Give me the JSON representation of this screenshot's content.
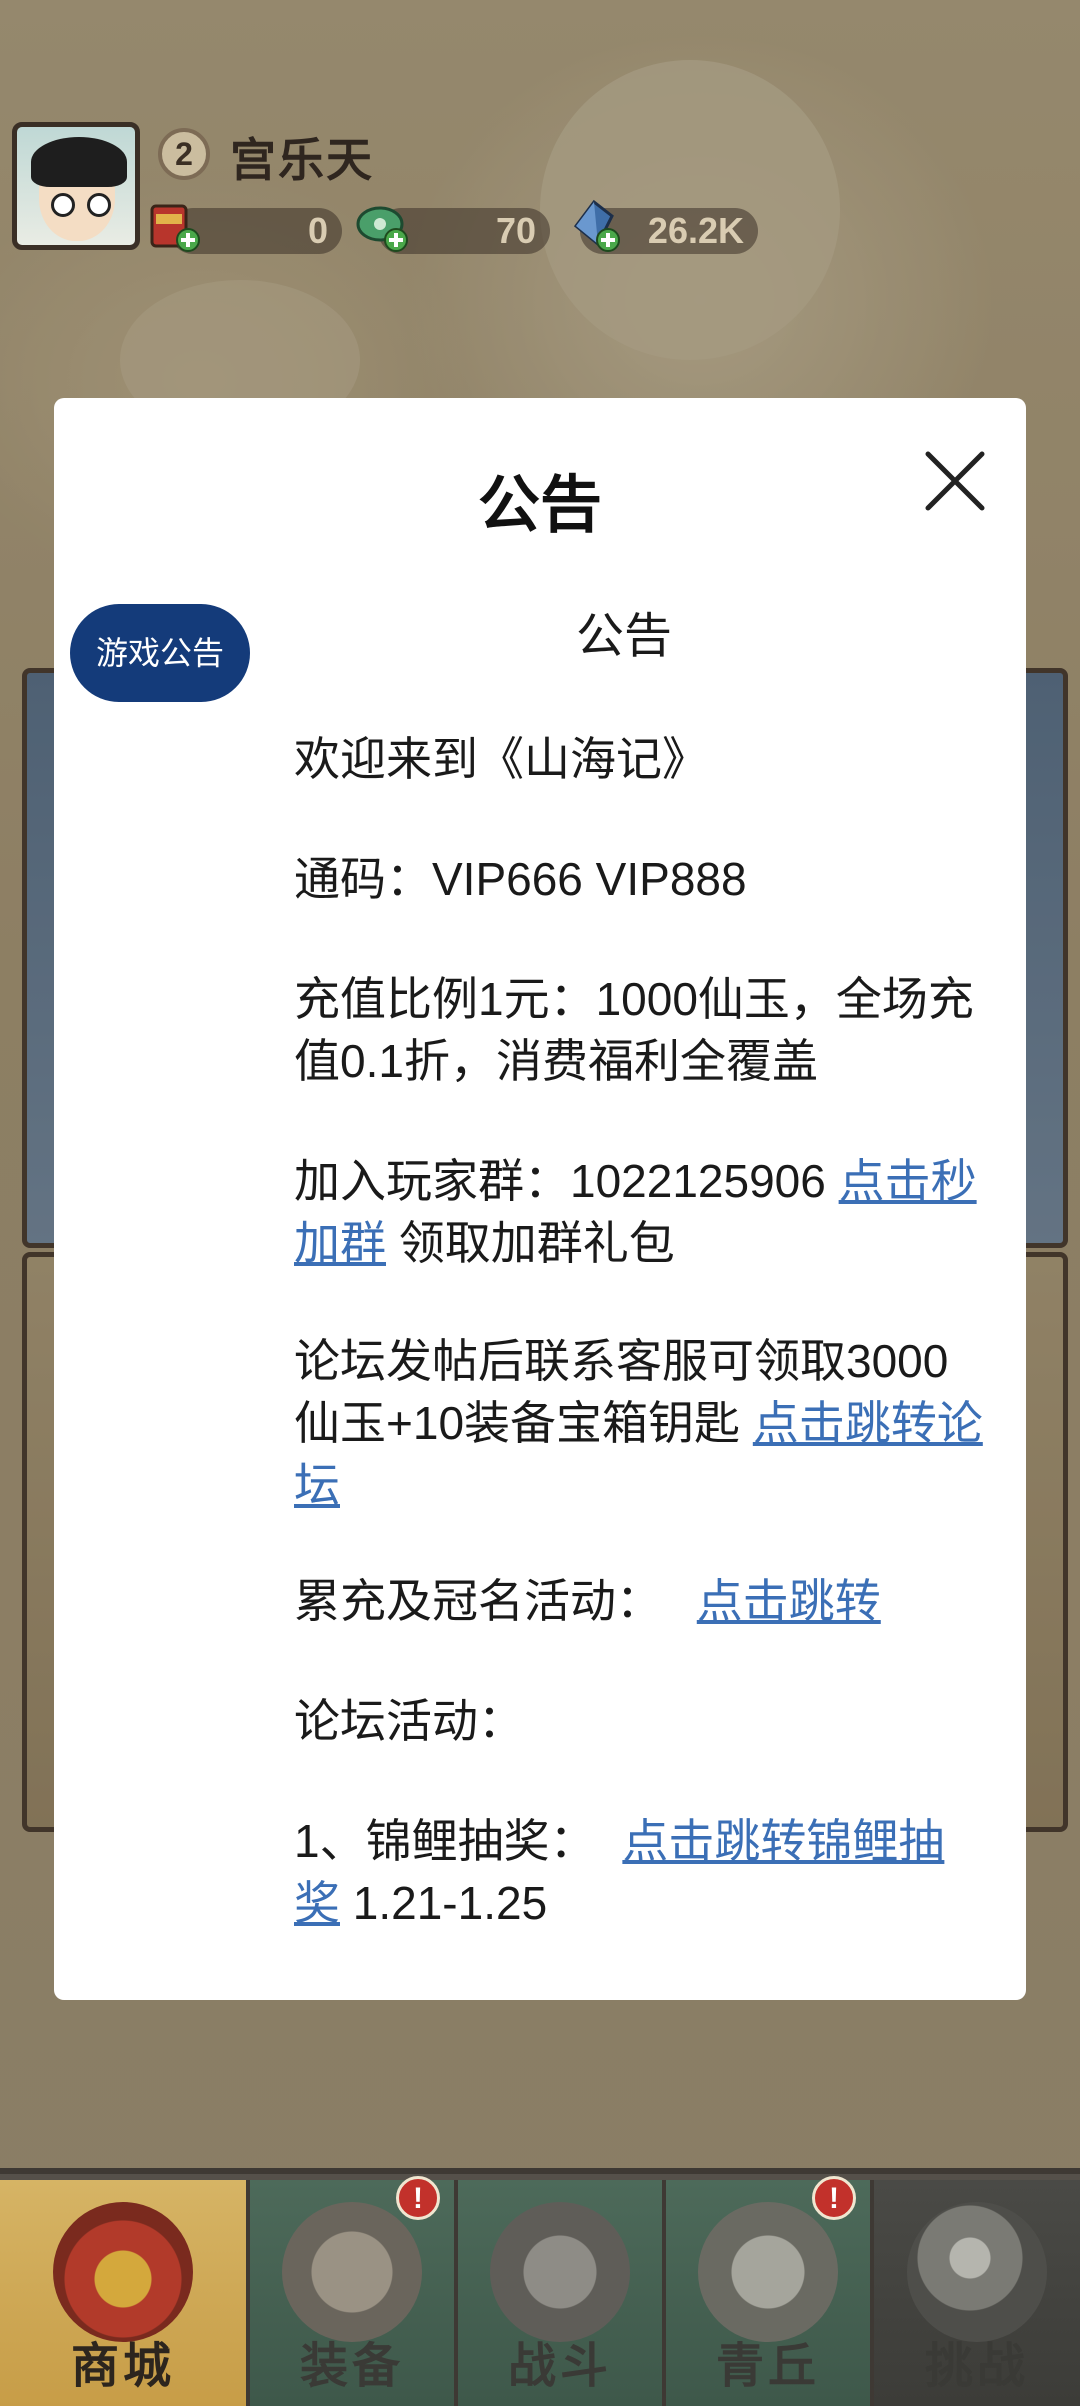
{
  "player": {
    "level": "2",
    "name": "宫乐天",
    "resources": [
      {
        "icon": "red-envelope-icon",
        "value": "0"
      },
      {
        "icon": "jade-coin-icon",
        "value": "70"
      },
      {
        "icon": "crystal-icon",
        "value": "26.2K"
      }
    ]
  },
  "modal": {
    "title": "公告",
    "close_icon": "close-icon",
    "tabs": [
      {
        "label": "游戏公告",
        "active": true
      }
    ],
    "content": {
      "heading": "公告",
      "welcome": "欢迎来到《山海记》",
      "code": "通码：VIP666 VIP888",
      "recharge": "充值比例1元：1000仙玉，全场充值0.1折，消费福利全覆盖",
      "group_text": "加入玩家群：1022125906",
      "group_link": "点击秒加群",
      "group_suffix": "领取加群礼包",
      "forum_text": "论坛发帖后联系客服可领取3000仙玉+10装备宝箱钥匙",
      "forum_link": "点击跳转论坛",
      "cumulative_text": "累充及冠名活动：",
      "cumulative_link": "点击跳转",
      "forum_activity": "论坛活动：",
      "lottery_text": "1、锦鲤抽奖：",
      "lottery_link": "点击跳转锦鲤抽奖",
      "lottery_dates": "1.21-1.25"
    }
  },
  "bottom_nav": [
    {
      "label": "商城",
      "active": true,
      "alert": false
    },
    {
      "label": "装备",
      "active": false,
      "alert": true,
      "alert_text": "!"
    },
    {
      "label": "战斗",
      "active": false,
      "alert": false
    },
    {
      "label": "青丘",
      "active": false,
      "alert": true,
      "alert_text": "!"
    },
    {
      "label": "挑战",
      "active": false,
      "alert": false
    }
  ],
  "colors": {
    "link": "#3b6fb6",
    "tab_active_bg": "#143b7a",
    "alert": "#c2312b"
  }
}
